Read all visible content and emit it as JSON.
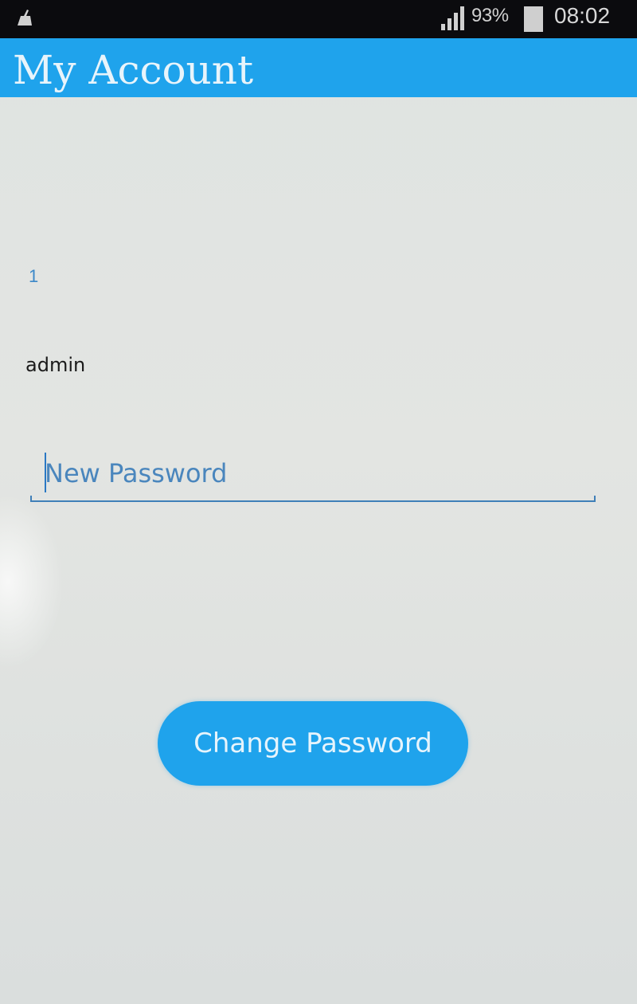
{
  "status_bar": {
    "battery_percent": "93%",
    "time": "08:02",
    "icons": [
      "cleaner-icon",
      "signal-icon",
      "battery-icon"
    ]
  },
  "app_bar": {
    "title": "My Account",
    "color": "#1fa3ec"
  },
  "account": {
    "user_id": "1",
    "username": "admin"
  },
  "form": {
    "new_password_placeholder": "New Password",
    "new_password_value": "",
    "change_password_label": "Change Password"
  },
  "colors": {
    "accent": "#1fa3ec",
    "background": "#e0e3e1"
  }
}
